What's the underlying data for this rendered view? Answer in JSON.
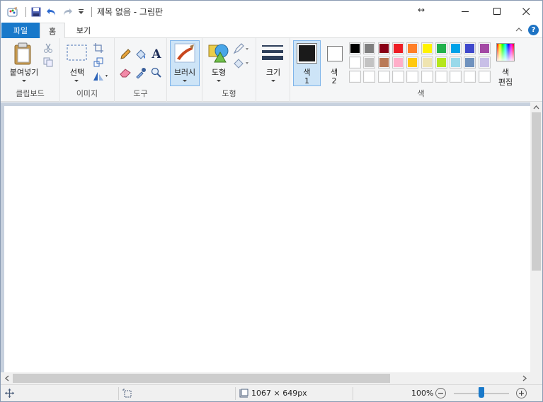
{
  "window": {
    "title": "제목 없음 - 그림판",
    "resize_glyph": "↔"
  },
  "ribbon_tabs": [
    {
      "label": "파일"
    },
    {
      "label": "홈"
    },
    {
      "label": "보기"
    }
  ],
  "help_label": "?",
  "groups": {
    "clipboard": {
      "label": "클립보드",
      "paste_label": "붙여넣기"
    },
    "image": {
      "label": "이미지",
      "select_label": "선택"
    },
    "tools": {
      "label": "도구",
      "text_glyph": "A"
    },
    "brushes": {
      "label": "브러시"
    },
    "shapes": {
      "label": "도형",
      "shapes_label": "도형"
    },
    "size": {
      "label": "크기"
    },
    "colors": {
      "label": "색",
      "color1_label_line1": "색",
      "color1_label_line2": "1",
      "color2_label_line1": "색",
      "color2_label_line2": "2",
      "edit_label_line1": "색",
      "edit_label_line2": "편집",
      "color1_value": "#1a1a1a",
      "color2_value": "#ffffff",
      "palette_row1": [
        "#000000",
        "#7f7f7f",
        "#880015",
        "#ed1c24",
        "#ff7f27",
        "#fff200",
        "#22b14c",
        "#00a2e8",
        "#3f48cc",
        "#a349a4"
      ],
      "palette_row2": [
        "#ffffff",
        "#c3c3c3",
        "#b97a57",
        "#ffaec9",
        "#ffc90e",
        "#efe4b0",
        "#b5e61d",
        "#99d9ea",
        "#7092be",
        "#c8bfe7"
      ],
      "palette_row3": [
        "#ffffff",
        "#ffffff",
        "#ffffff",
        "#ffffff",
        "#ffffff",
        "#ffffff",
        "#ffffff",
        "#ffffff",
        "#ffffff",
        "#ffffff"
      ]
    }
  },
  "status": {
    "canvas_size": "1067 × 649px",
    "zoom": "100%"
  }
}
